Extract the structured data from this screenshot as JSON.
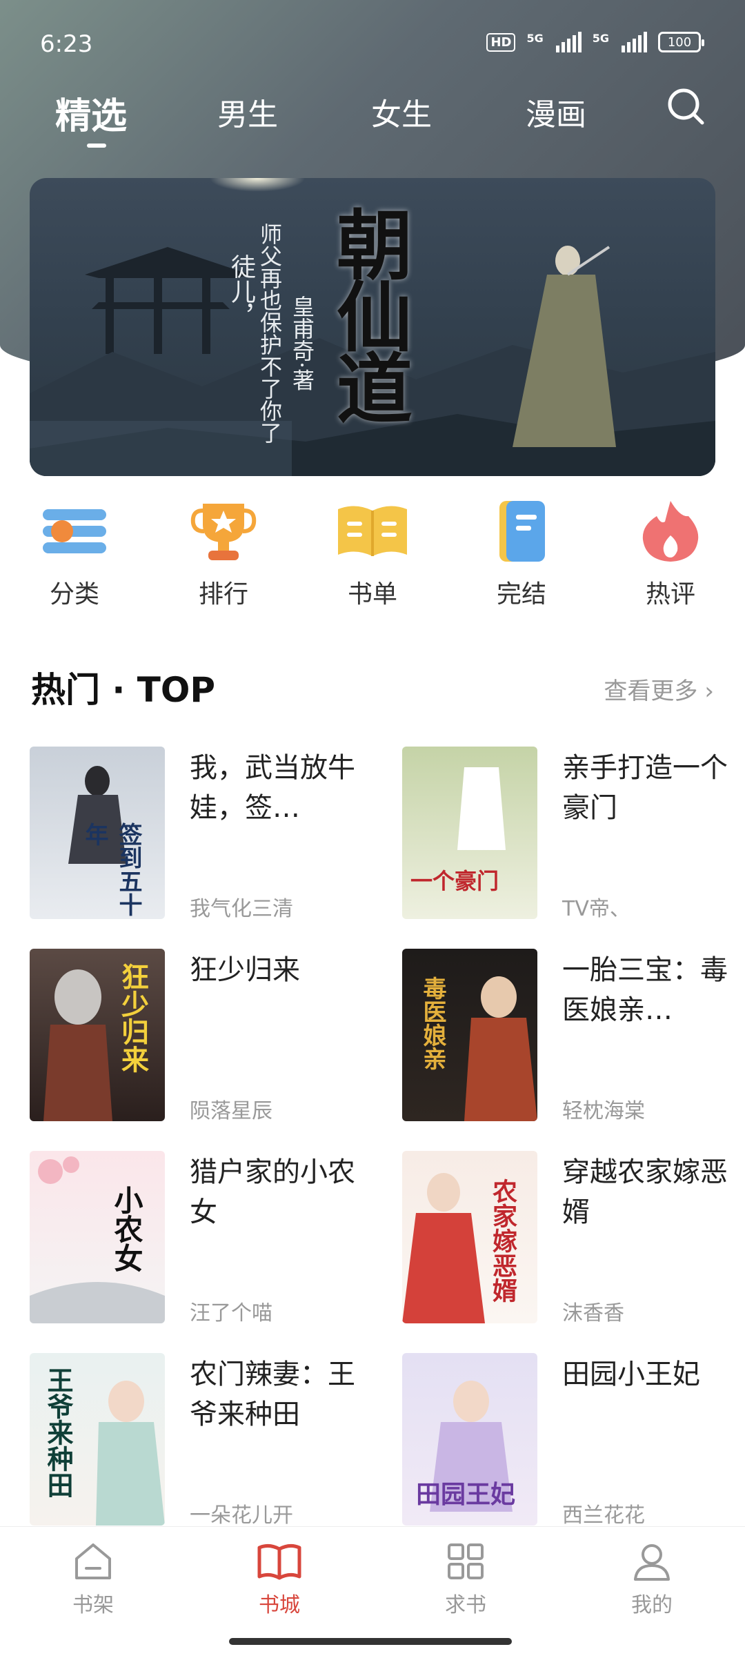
{
  "status_bar": {
    "time": "6:23",
    "hd": "HD",
    "network1": "5G",
    "network2": "5G",
    "battery": "100"
  },
  "tabs": [
    {
      "label": "精选",
      "active": true
    },
    {
      "label": "男生",
      "active": false
    },
    {
      "label": "女生",
      "active": false
    },
    {
      "label": "漫画",
      "active": false
    }
  ],
  "banner": {
    "title": "朝仙道",
    "tagline_1": "徒儿，",
    "tagline_2": "师父再也保护不了你了",
    "author": "皇甫奇·著"
  },
  "quick_nav": [
    {
      "label": "分类",
      "icon": "category-icon"
    },
    {
      "label": "排行",
      "icon": "trophy-icon"
    },
    {
      "label": "书单",
      "icon": "book-list-icon"
    },
    {
      "label": "完结",
      "icon": "finished-icon"
    },
    {
      "label": "热评",
      "icon": "fire-icon"
    }
  ],
  "section": {
    "title": "热门 · TOP",
    "more_label": "查看更多"
  },
  "books": [
    {
      "title": "我，武当放牛娃，签…",
      "author": "我气化三清",
      "cover_text": "签到五十年"
    },
    {
      "title": "亲手打造一个豪门",
      "author": "TV帝、",
      "cover_text": "一个豪门"
    },
    {
      "title": "狂少归来",
      "author": "陨落星辰",
      "cover_text": "狂少归来"
    },
    {
      "title": "一胎三宝：毒医娘亲…",
      "author": "轻枕海棠",
      "cover_text": "毒医娘亲"
    },
    {
      "title": "猎户家的小农女",
      "author": "汪了个喵",
      "cover_text": "小农女"
    },
    {
      "title": "穿越农家嫁恶婿",
      "author": "沫香香",
      "cover_text": "农家嫁恶婿"
    },
    {
      "title": "农门辣妻：王爷来种田",
      "author": "一朵花儿开",
      "cover_text": "王爷来种田"
    },
    {
      "title": "田园小王妃",
      "author": "西兰花花",
      "cover_text": "田园王妃"
    }
  ],
  "bottom_nav": [
    {
      "label": "书架",
      "active": false
    },
    {
      "label": "书城",
      "active": true
    },
    {
      "label": "求书",
      "active": false
    },
    {
      "label": "我的",
      "active": false
    }
  ],
  "colors": {
    "accent": "#d8463c",
    "muted": "#999999"
  }
}
